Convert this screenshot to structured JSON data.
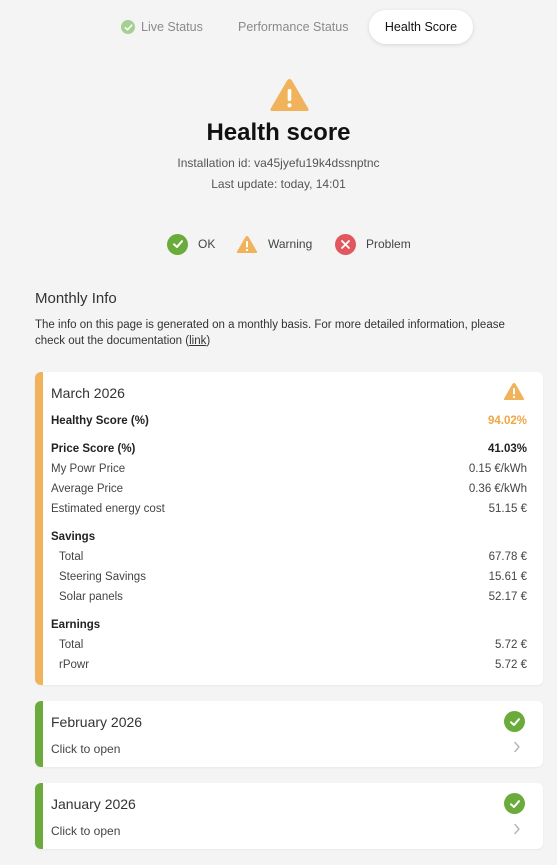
{
  "tabs": {
    "live": "Live Status",
    "performance": "Performance Status",
    "health": "Health Score"
  },
  "hero": {
    "title": "Health score",
    "installation": "Installation id: va45jyefu19k4dssnptnc",
    "last_update": "Last update: today, 14:01"
  },
  "legend": {
    "ok": "OK",
    "warning": "Warning",
    "problem": "Problem"
  },
  "monthly": {
    "title": "Monthly Info",
    "desc_before": "The info on this page is generated on a monthly basis. For more detailed information, please check out the documentation (",
    "link": "link",
    "desc_after": ")"
  },
  "colors": {
    "warning": "#f0b35c",
    "ok": "#6aab3c",
    "problem": "#e0585d"
  },
  "march": {
    "title": "March 2026",
    "status_icon": "warning-icon",
    "healthy_label": "Healthy Score (%)",
    "healthy_value": "94.02%",
    "price_label": "Price Score (%)",
    "price_value": "41.03%",
    "my_price_label": "My Powr Price",
    "my_price_value": "0.15 €/kWh",
    "avg_price_label": "Average Price",
    "avg_price_value": "0.36 €/kWh",
    "est_cost_label": "Estimated energy cost",
    "est_cost_value": "51.15 €",
    "savings_label": "Savings",
    "savings_total_label": "Total",
    "savings_total_value": "67.78 €",
    "steering_label": "Steering Savings",
    "steering_value": "15.61 €",
    "solar_label": "Solar panels",
    "solar_value": "52.17 €",
    "earnings_label": "Earnings",
    "earnings_total_label": "Total",
    "earnings_total_value": "5.72 €",
    "rpowr_label": "rPowr",
    "rpowr_value": "5.72 €"
  },
  "february": {
    "title": "February 2026",
    "status_icon": "check-icon",
    "click": "Click to open"
  },
  "january": {
    "title": "January 2026",
    "status_icon": "check-icon",
    "click": "Click to open"
  }
}
